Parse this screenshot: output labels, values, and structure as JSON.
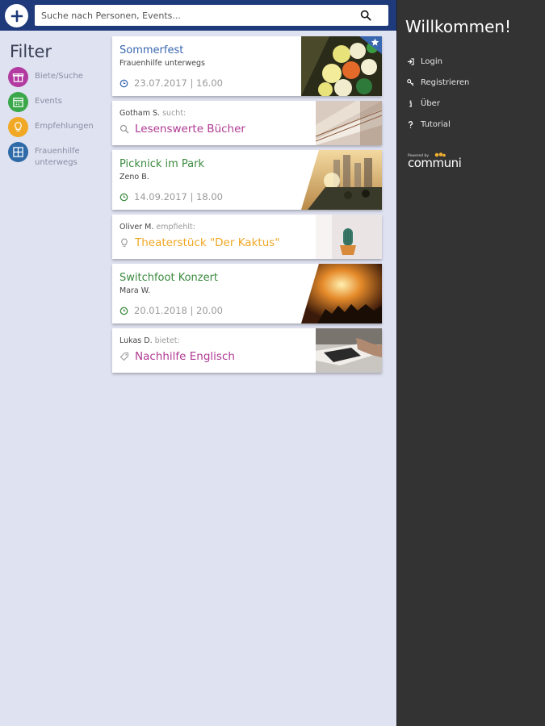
{
  "search": {
    "placeholder": "Suche nach Personen, Events..."
  },
  "filter": {
    "title": "Filter",
    "items": [
      {
        "label": "Biete/Suche",
        "color": "#b23aa0",
        "icon": "gift-icon"
      },
      {
        "label": "Events",
        "color": "#3aa84a",
        "icon": "calendar-icon"
      },
      {
        "label": "Empfehlungen",
        "color": "#f0a825",
        "icon": "lightbulb-icon"
      },
      {
        "label": "Frauenhilfe unterwegs",
        "color": "#2e6aa8",
        "icon": "group-icon"
      }
    ]
  },
  "feed": {
    "cards": [
      {
        "kind": "event",
        "title": "Sommerfest",
        "subtitle": "Frauenhilfe unterwegs",
        "date": "23.07.2017 | 16.00",
        "title_color": "#3a68b0",
        "starred": true
      },
      {
        "kind": "post",
        "user": "Gotham S.",
        "verb": "sucht:",
        "item": "Lesenswerte Bücher",
        "color": "#b03a93",
        "icon": "search-icon"
      },
      {
        "kind": "event",
        "title": "Picknick im Park",
        "subtitle": "Zeno B.",
        "date": "14.09.2017 | 18.00",
        "title_color": "#3b8a3e"
      },
      {
        "kind": "post",
        "user": "Oliver M.",
        "verb": "empfiehlt:",
        "item": "Theaterstück \"Der Kaktus\"",
        "color": "#f0a825",
        "icon": "lightbulb-icon"
      },
      {
        "kind": "event",
        "title": "Switchfoot Konzert",
        "subtitle": "Mara W.",
        "date": "20.01.2018 | 20.00",
        "title_color": "#3b8a3e"
      },
      {
        "kind": "post",
        "user": "Lukas D.",
        "verb": "bietet:",
        "item": "Nachhilfe Englisch",
        "color": "#b03a93",
        "icon": "tag-icon"
      }
    ]
  },
  "side": {
    "welcome": "Willkommen!",
    "menu": [
      {
        "label": "Login",
        "icon": "login-icon"
      },
      {
        "label": "Registrieren",
        "icon": "key-icon"
      },
      {
        "label": "Über",
        "icon": "info-icon"
      },
      {
        "label": "Tutorial",
        "icon": "question-icon"
      }
    ],
    "logo_small": "Powered by",
    "logo_text": "communi"
  },
  "colors": {
    "topbar": "#1f3a7a",
    "background": "#dfe2f1",
    "side": "#333333"
  }
}
